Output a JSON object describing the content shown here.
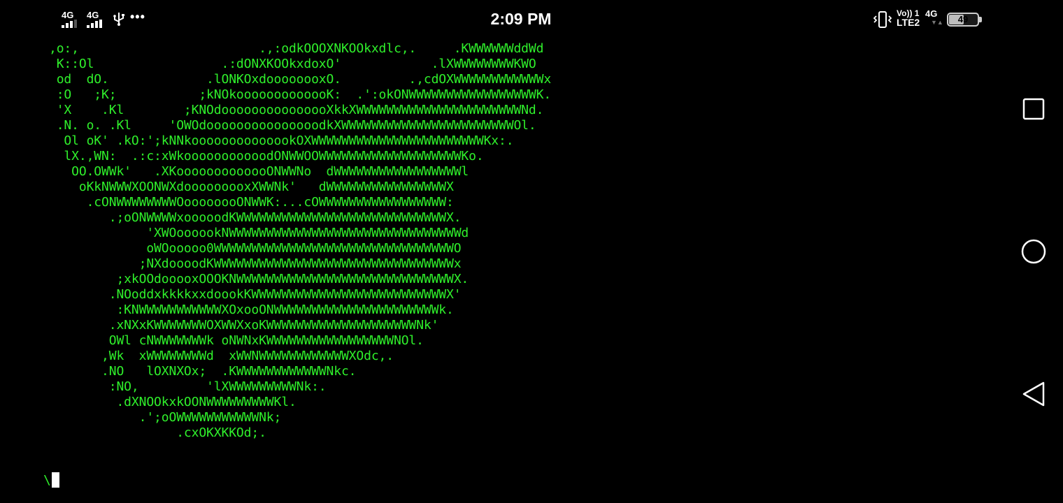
{
  "status_bar": {
    "time": "2:09 PM",
    "sim1_network": "4G",
    "sim2_network": "4G",
    "volte_top": "Vo)) 1",
    "volte_bottom": "LTE2",
    "data_network": "4G",
    "battery_level": "49",
    "battery_fraction": 0.49,
    "icons": [
      "signal-icon",
      "signal-icon",
      "usb-icon",
      "more-notifications-icon",
      "vibrate-icon",
      "battery-icon"
    ]
  },
  "terminal": {
    "text_color": "#2ff02b",
    "background": "#000000",
    "ascii_art": [
      ",o:,                        .,:odkOOOXNKOOkxdlc,.     .KWWWWWWddWd",
      " K::Ol                 .:dONXKOOkxdoxO'            .lXWWWWWWWWKWO",
      " od  dO.             .lONKOxdoooooooxO.         .,cdOXWWWWWWWWWWWWx",
      " :O   ;K;           ;kNOkooooooooooooK:  .':okONWWWWWWWWWWWWWWWWWK.",
      " 'X    .Kl        ;KNOdooooooooooooooXkkXWWWWWWWWWWWWWWWWWWWWWWNd.",
      " .N. o. .Kl     'OWOdooooooooooooooodkXWWWWWWWWWWWWWWWWWWWWWWWOl.",
      "  Ol oK' .kO:';kNNkoooooooooooookOXWWWWWWWWWWWWWWWWWWWWWWWKx:.",
      "  lX.,WN:  .:c:xWkooooooooooodONWWOOWWWWWWWWWWWWWWWWWWWKo.",
      "   OO.OWWk'   .XKooooooooooooONWWNo  dWWWWWWWWWWWWWWWWWl",
      "    oKkNWWWXOONWXdooooooooxXWWNk'   dWWWWWWWWWWWWWWWWX",
      "     .cONWWWWWWWWOoooooooONWWK:...cOWWWWWWWWWWWWWWWWW:",
      "        .;oONWWWWxooooodKWWWWWWWWWWWWWWWWWWWWWWWWWWWWX.",
      "             'XWOoooookNWWWWWWWWWWWWWWWWWWWWWWWWWWWWWWWd",
      "             oWOooooo0WWWWWWWWWWWWWWWWWWWWWWWWWWWWWWWWO",
      "            ;NXdoooodKWWWWWWWWWWWWWWWWWWWWWWWWWWWWWWWWx",
      "         ;xkOOdooooxOOOKNWWWWWWWWWWWWWWWWWWWWWWWWWWWWWX.",
      "        .NOoddxkkkkxxdoookKWWWWWWWWWWWWWWWWWWWWWWWWWWX'",
      "         :KNWWWWWWWWWWWXOxooONWWWWWWWWWWWWWWWWWWWWWWk.",
      "        .xNXxKWWWWWWWOXWWXxoKWWWWWWWWWWWWWWWWWWWWNk'",
      "        OWl cNWWWWWWWk oNWNxKWWWWWWWWWWWWWWWWWNOl.",
      "       ,Wk  xWWWWWWWWd  xWWNWWWWWWWWWWWWXOdc,.",
      "       .NO   lOXNXOx;  .KWWWWWWWWWWWWNkc.",
      "        :NO,         'lXWWWWWWWWWNk:.",
      "         .dXNOOkxkOONWWWWWWWWWKl.",
      "            .';oOWWWWWWWWWWWNk;",
      "                 .cxOKXKKOd;."
    ],
    "prompt_char": "\\"
  },
  "nav_bar": {
    "buttons": [
      "recents-icon",
      "home-icon",
      "back-icon"
    ]
  }
}
